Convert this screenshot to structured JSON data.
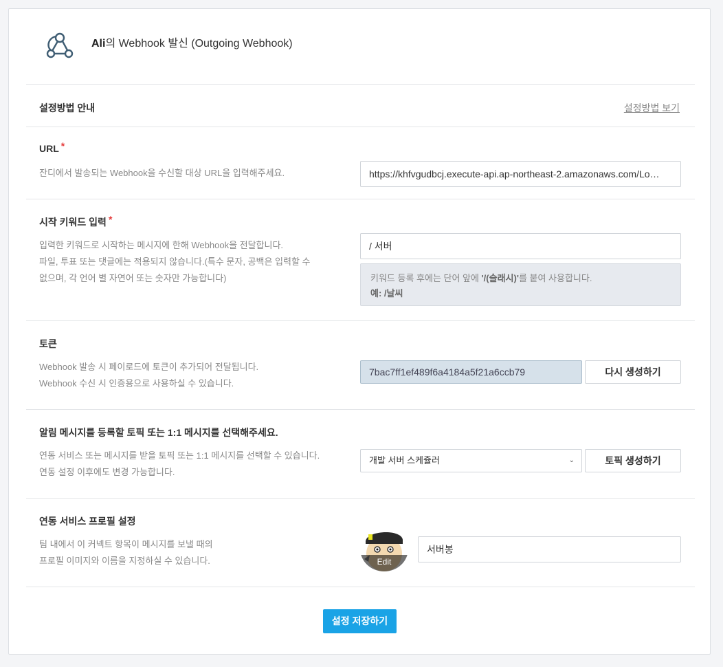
{
  "header": {
    "user": "Ali",
    "title_suffix": "의 Webhook 발신 (Outgoing Webhook)"
  },
  "guide": {
    "title": "설정방법 안내",
    "link": "설정방법 보기"
  },
  "url_section": {
    "title": "URL",
    "required": "*",
    "desc": "잔디에서 발송되는 Webhook을 수신할 대상 URL을 입력해주세요.",
    "value": "https://khfvgudbcj.execute-api.ap-northeast-2.amazonaws.com/Lo…"
  },
  "keyword_section": {
    "title": "시작 키워드 입력",
    "required": "*",
    "desc_lines": [
      "입력한 키워드로 시작하는 메시지에 한해 Webhook을 전달합니다.",
      "파일, 투표 또는 댓글에는 적용되지 않습니다.(특수 문자, 공백은 입력할 수",
      "없으며, 각 언어 별 자연어 또는 숫자만 가능합니다)"
    ],
    "value": "/ 서버",
    "note_prefix": "키워드 등록 후에는 단어 앞에 ",
    "note_bold": "'/(슬래시)'",
    "note_suffix": "를 붙여 사용합니다.",
    "note_example": "예: /날씨"
  },
  "token_section": {
    "title": "토큰",
    "desc_lines": [
      "Webhook 발송 시 페이로드에 토큰이 추가되어 전달됩니다.",
      "Webhook 수신 시 인증용으로 사용하실 수 있습니다."
    ],
    "value": "7bac7ff1ef489f6a4184a5f21a6ccb79",
    "regen_button": "다시 생성하기"
  },
  "topic_section": {
    "title": "알림 메시지를 등록할 토픽 또는 1:1 메시지를 선택해주세요.",
    "desc_lines": [
      "연동 서비스 또는 메시지를 받을 토픽 또는 1:1 메시지를 선택할 수 있습니다.",
      "연동 설정 이후에도 변경 가능합니다."
    ],
    "selected": "개발 서버 스케쥴러",
    "create_button": "토픽 생성하기"
  },
  "profile_section": {
    "title": "연동 서비스 프로필 설정",
    "desc_lines": [
      "팀 내에서 이 커넥트 항목이 메시지를 보낼 때의",
      "프로필 이미지와 이름을 지정하실 수 있습니다."
    ],
    "avatar_edit": "Edit",
    "name_value": "서버봉"
  },
  "save_button": "설정 저장하기",
  "colors": {
    "accent": "#1aa3e6",
    "required": "#e53b3b",
    "token_bg": "#d6e1ea"
  },
  "icons": {
    "logo": "webhook-icon",
    "select": "chevron-down-icon"
  }
}
